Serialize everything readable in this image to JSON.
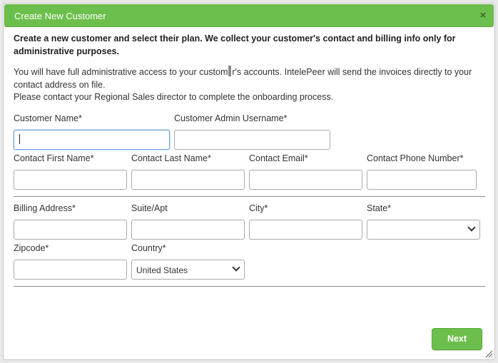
{
  "dialog": {
    "title": "Create New Customer",
    "close_glyph": "×"
  },
  "intro": {
    "text": "Create a new customer and select their plan. We collect your customer's contact and billing info only for administrative purposes."
  },
  "info": {
    "line1_part1": "You will have full administrative access to your custom",
    "line1_part2": "r's accounts. IntelePeer will send the invoices directly to your contact address on file.",
    "line2": "Please contact your Regional Sales director to complete the onboarding process."
  },
  "fields": {
    "customer_name": {
      "label": "Customer Name*",
      "value": ""
    },
    "admin_username": {
      "label": "Customer Admin Username*",
      "value": ""
    },
    "first_name": {
      "label": "Contact First Name*",
      "value": ""
    },
    "last_name": {
      "label": "Contact Last Name*",
      "value": ""
    },
    "email": {
      "label": "Contact Email*",
      "value": ""
    },
    "phone": {
      "label": "Contact Phone Number*",
      "value": ""
    },
    "billing_address": {
      "label": "Billing Address*",
      "value": ""
    },
    "suite": {
      "label": "Suite/Apt",
      "value": ""
    },
    "city": {
      "label": "City*",
      "value": ""
    },
    "state": {
      "label": "State*",
      "value": ""
    },
    "zipcode": {
      "label": "Zipcode*",
      "value": ""
    },
    "country": {
      "label": "Country*",
      "value": "United States"
    }
  },
  "actions": {
    "next_label": "Next"
  },
  "colors": {
    "accent": "#6cbf4c",
    "focus": "#6fa0d8"
  }
}
